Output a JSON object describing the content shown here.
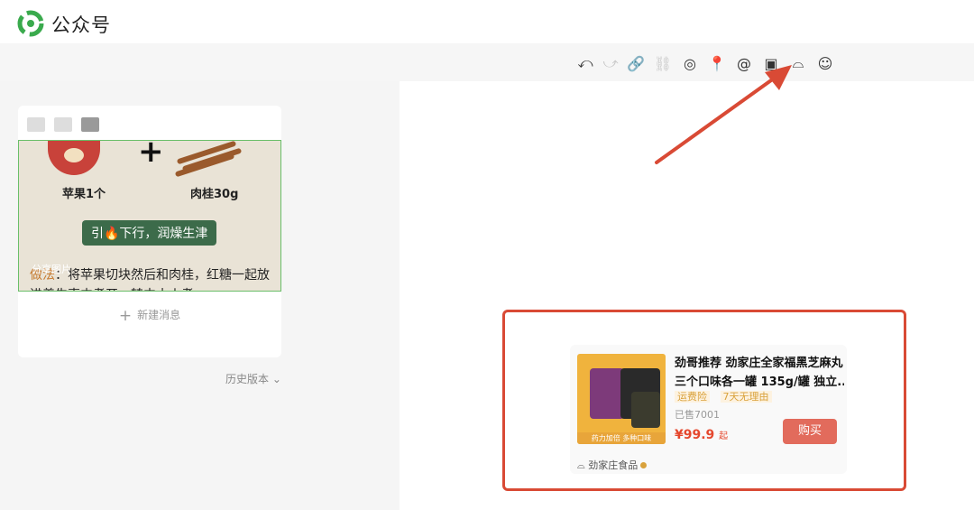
{
  "header": {
    "app_title": "公众号"
  },
  "colors": {
    "brand_green": "#3aaa4d",
    "annotation_red": "#d94a35",
    "buy_button": "#e26b5c"
  },
  "toolbar": {
    "icons": [
      {
        "name": "undo-icon",
        "glyph": "⤺",
        "enabled": true
      },
      {
        "name": "redo-icon",
        "glyph": "⤻",
        "enabled": false
      },
      {
        "name": "link-icon",
        "glyph": "🔗",
        "enabled": true
      },
      {
        "name": "unlink-icon",
        "glyph": "⛓",
        "enabled": false
      },
      {
        "name": "mini-program-icon",
        "glyph": "◎",
        "enabled": true
      },
      {
        "name": "location-icon",
        "glyph": "📍",
        "enabled": true
      },
      {
        "name": "mention-icon",
        "glyph": "@",
        "enabled": true
      },
      {
        "name": "inbox-icon",
        "glyph": "▣",
        "enabled": true
      },
      {
        "name": "shop-icon",
        "glyph": "⌓",
        "enabled": true
      },
      {
        "name": "emoji-icon",
        "glyph": "☺",
        "enabled": true
      }
    ]
  },
  "article_card": {
    "thumb": {
      "label_left": "苹果1个",
      "label_right": "肉桂30g",
      "tag_text": "引🔥下行，润燥生津",
      "body_prefix": "做法",
      "body_text": "：将苹果切块然后和肉桂，红糖一起放进养生壶内煮开，转中小火煮",
      "share_label": "分享图片"
    },
    "new_message_label": "新建消息"
  },
  "history_label": "历史版本",
  "product": {
    "title_line1": "劲哥推荐 劲家庄全家福黑芝麻丸",
    "title_line2": "三个口味各一罐 135g/罐 独立...",
    "tags": [
      "运费险",
      "7天无理由"
    ],
    "sold": "已售7001",
    "price": "¥99.9",
    "price_suffix": "起",
    "buy_label": "购买",
    "shop_name": "劲家庄食品",
    "image_strip": "药力加倍 多种口味"
  }
}
